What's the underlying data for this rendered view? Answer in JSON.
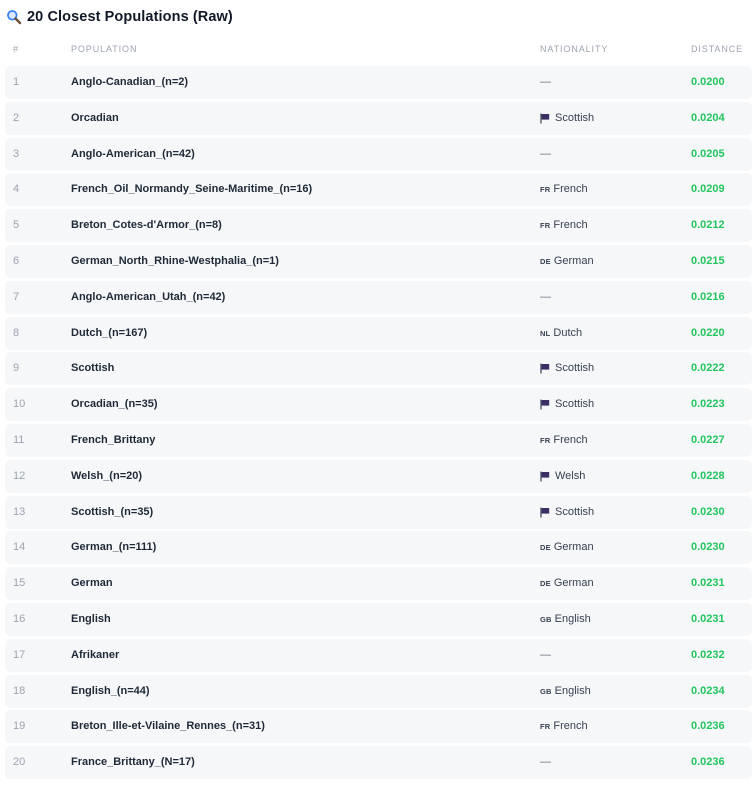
{
  "title": "20 Closest Populations (Raw)",
  "colors": {
    "distance": "#22c55e",
    "row_bg": "#f6f7f9",
    "header": "#9ca3af",
    "flag": "#3b2f63"
  },
  "columns": {
    "num": "#",
    "population": "POPULATION",
    "nationality": "NATIONALITY",
    "distance": "DISTANCE"
  },
  "rows": [
    {
      "num": "1",
      "population": "Anglo-Canadian_(n=2)",
      "nat_code": "",
      "nat_icon": "",
      "nationality": "—",
      "distance": "0.0200"
    },
    {
      "num": "2",
      "population": "Orcadian",
      "nat_code": "",
      "nat_icon": "flag-icon",
      "nationality": "Scottish",
      "distance": "0.0204"
    },
    {
      "num": "3",
      "population": "Anglo-American_(n=42)",
      "nat_code": "",
      "nat_icon": "",
      "nationality": "—",
      "distance": "0.0205"
    },
    {
      "num": "4",
      "population": "French_Oil_Normandy_Seine-Maritime_(n=16)",
      "nat_code": "FR",
      "nat_icon": "",
      "nationality": "French",
      "distance": "0.0209"
    },
    {
      "num": "5",
      "population": "Breton_Cotes-d'Armor_(n=8)",
      "nat_code": "FR",
      "nat_icon": "",
      "nationality": "French",
      "distance": "0.0212"
    },
    {
      "num": "6",
      "population": "German_North_Rhine-Westphalia_(n=1)",
      "nat_code": "DE",
      "nat_icon": "",
      "nationality": "German",
      "distance": "0.0215"
    },
    {
      "num": "7",
      "population": "Anglo-American_Utah_(n=42)",
      "nat_code": "",
      "nat_icon": "",
      "nationality": "—",
      "distance": "0.0216"
    },
    {
      "num": "8",
      "population": "Dutch_(n=167)",
      "nat_code": "NL",
      "nat_icon": "",
      "nationality": "Dutch",
      "distance": "0.0220"
    },
    {
      "num": "9",
      "population": "Scottish",
      "nat_code": "",
      "nat_icon": "flag-icon",
      "nationality": "Scottish",
      "distance": "0.0222"
    },
    {
      "num": "10",
      "population": "Orcadian_(n=35)",
      "nat_code": "",
      "nat_icon": "flag-icon",
      "nationality": "Scottish",
      "distance": "0.0223"
    },
    {
      "num": "11",
      "population": "French_Brittany",
      "nat_code": "FR",
      "nat_icon": "",
      "nationality": "French",
      "distance": "0.0227"
    },
    {
      "num": "12",
      "population": "Welsh_(n=20)",
      "nat_code": "",
      "nat_icon": "flag-icon",
      "nationality": "Welsh",
      "distance": "0.0228"
    },
    {
      "num": "13",
      "population": "Scottish_(n=35)",
      "nat_code": "",
      "nat_icon": "flag-icon",
      "nationality": "Scottish",
      "distance": "0.0230"
    },
    {
      "num": "14",
      "population": "German_(n=111)",
      "nat_code": "DE",
      "nat_icon": "",
      "nationality": "German",
      "distance": "0.0230"
    },
    {
      "num": "15",
      "population": "German",
      "nat_code": "DE",
      "nat_icon": "",
      "nationality": "German",
      "distance": "0.0231"
    },
    {
      "num": "16",
      "population": "English",
      "nat_code": "GB",
      "nat_icon": "",
      "nationality": "English",
      "distance": "0.0231"
    },
    {
      "num": "17",
      "population": "Afrikaner",
      "nat_code": "",
      "nat_icon": "",
      "nationality": "—",
      "distance": "0.0232"
    },
    {
      "num": "18",
      "population": "English_(n=44)",
      "nat_code": "GB",
      "nat_icon": "",
      "nationality": "English",
      "distance": "0.0234"
    },
    {
      "num": "19",
      "population": "Breton_Ille-et-Vilaine_Rennes_(n=31)",
      "nat_code": "FR",
      "nat_icon": "",
      "nationality": "French",
      "distance": "0.0236"
    },
    {
      "num": "20",
      "population": "France_Brittany_(N=17)",
      "nat_code": "",
      "nat_icon": "",
      "nationality": "—",
      "distance": "0.0236"
    }
  ]
}
